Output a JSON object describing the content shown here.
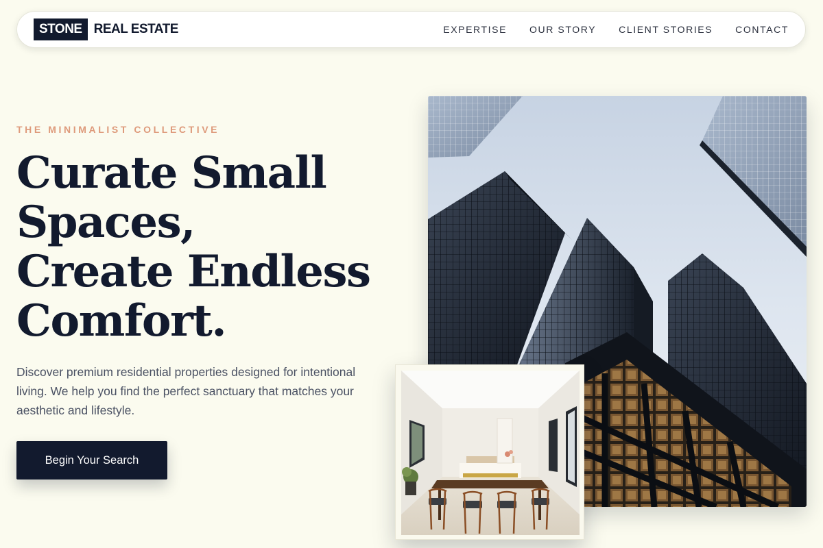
{
  "brand": {
    "box_text": "STONE",
    "text": "REAL ESTATE",
    "colors": {
      "primary": "#121a2e",
      "accent": "#de9a7b",
      "background": "#fbfbef"
    }
  },
  "nav": {
    "items": [
      {
        "label": "EXPERTISE"
      },
      {
        "label": "OUR STORY"
      },
      {
        "label": "CLIENT STORIES"
      },
      {
        "label": "CONTACT"
      }
    ]
  },
  "hero": {
    "eyebrow": "THE MINIMALIST COLLECTIVE",
    "headline_lines": [
      "Curate Small",
      "Spaces,",
      "Create Endless",
      "Comfort."
    ],
    "description": "Discover premium residential properties designed for intentional living. We help you find the perfect sanctuary that matches your aesthetic and lifestyle.",
    "cta_label": "Begin Your Search"
  },
  "images": {
    "main_icon": "skyscrapers-photo",
    "secondary_icon": "dining-room-photo"
  }
}
